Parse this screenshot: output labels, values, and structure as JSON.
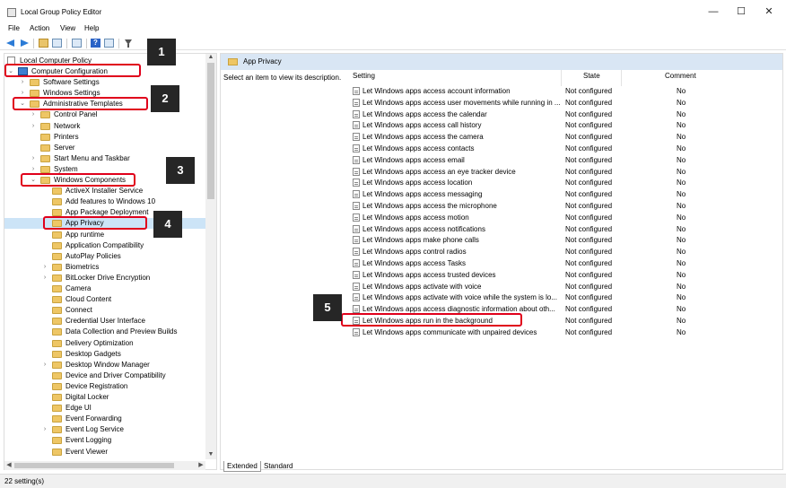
{
  "window": {
    "title": "Local Group Policy Editor",
    "minimize_glyph": "—",
    "maximize_glyph": "☐",
    "close_glyph": "✕"
  },
  "menu": [
    "File",
    "Action",
    "View",
    "Help"
  ],
  "tree": {
    "root": "Local Computer Policy",
    "items": [
      {
        "label": "Computer Configuration",
        "level": 0,
        "expander": "v",
        "icon": "computer-icon"
      },
      {
        "label": "Software Settings",
        "level": 1,
        "expander": ">",
        "icon": "folder-icon"
      },
      {
        "label": "Windows Settings",
        "level": 1,
        "expander": ">",
        "icon": "folder-icon"
      },
      {
        "label": "Administrative Templates",
        "level": 1,
        "expander": "v",
        "icon": "folder-icon"
      },
      {
        "label": "Control Panel",
        "level": 2,
        "expander": ">",
        "icon": "folder-icon"
      },
      {
        "label": "Network",
        "level": 2,
        "expander": ">",
        "icon": "folder-icon"
      },
      {
        "label": "Printers",
        "level": 2,
        "expander": "",
        "icon": "folder-icon"
      },
      {
        "label": "Server",
        "level": 2,
        "expander": "",
        "icon": "folder-icon"
      },
      {
        "label": "Start Menu and Taskbar",
        "level": 2,
        "expander": ">",
        "icon": "folder-icon"
      },
      {
        "label": "System",
        "level": 2,
        "expander": ">",
        "icon": "folder-icon"
      },
      {
        "label": "Windows Components",
        "level": 2,
        "expander": "v",
        "icon": "folder-icon"
      },
      {
        "label": "ActiveX Installer Service",
        "level": 3,
        "expander": "",
        "icon": "folder-icon"
      },
      {
        "label": "Add features to Windows 10",
        "level": 3,
        "expander": "",
        "icon": "folder-icon"
      },
      {
        "label": "App Package Deployment",
        "level": 3,
        "expander": "",
        "icon": "folder-icon"
      },
      {
        "label": "App Privacy",
        "level": 3,
        "expander": "",
        "icon": "folder-icon",
        "selected": true
      },
      {
        "label": "App runtime",
        "level": 3,
        "expander": "",
        "icon": "folder-icon"
      },
      {
        "label": "Application Compatibility",
        "level": 3,
        "expander": "",
        "icon": "folder-icon"
      },
      {
        "label": "AutoPlay Policies",
        "level": 3,
        "expander": "",
        "icon": "folder-icon"
      },
      {
        "label": "Biometrics",
        "level": 3,
        "expander": ">",
        "icon": "folder-icon"
      },
      {
        "label": "BitLocker Drive Encryption",
        "level": 3,
        "expander": ">",
        "icon": "folder-icon"
      },
      {
        "label": "Camera",
        "level": 3,
        "expander": "",
        "icon": "folder-icon"
      },
      {
        "label": "Cloud Content",
        "level": 3,
        "expander": "",
        "icon": "folder-icon"
      },
      {
        "label": "Connect",
        "level": 3,
        "expander": "",
        "icon": "folder-icon"
      },
      {
        "label": "Credential User Interface",
        "level": 3,
        "expander": "",
        "icon": "folder-icon"
      },
      {
        "label": "Data Collection and Preview Builds",
        "level": 3,
        "expander": "",
        "icon": "folder-icon"
      },
      {
        "label": "Delivery Optimization",
        "level": 3,
        "expander": "",
        "icon": "folder-icon"
      },
      {
        "label": "Desktop Gadgets",
        "level": 3,
        "expander": "",
        "icon": "folder-icon"
      },
      {
        "label": "Desktop Window Manager",
        "level": 3,
        "expander": ">",
        "icon": "folder-icon"
      },
      {
        "label": "Device and Driver Compatibility",
        "level": 3,
        "expander": "",
        "icon": "folder-icon"
      },
      {
        "label": "Device Registration",
        "level": 3,
        "expander": "",
        "icon": "folder-icon"
      },
      {
        "label": "Digital Locker",
        "level": 3,
        "expander": "",
        "icon": "folder-icon"
      },
      {
        "label": "Edge UI",
        "level": 3,
        "expander": "",
        "icon": "folder-icon"
      },
      {
        "label": "Event Forwarding",
        "level": 3,
        "expander": "",
        "icon": "folder-icon"
      },
      {
        "label": "Event Log Service",
        "level": 3,
        "expander": ">",
        "icon": "folder-icon"
      },
      {
        "label": "Event Logging",
        "level": 3,
        "expander": "",
        "icon": "folder-icon"
      },
      {
        "label": "Event Viewer",
        "level": 3,
        "expander": "",
        "icon": "folder-icon"
      }
    ]
  },
  "panel": {
    "title": "App Privacy",
    "description": "Select an item to view its description.",
    "columns": {
      "setting": "Setting",
      "state": "State",
      "comment": "Comment"
    },
    "rows": [
      {
        "name": "Let Windows apps access account information",
        "state": "Not configured",
        "comment": "No"
      },
      {
        "name": "Let Windows apps access user movements while running in ...",
        "state": "Not configured",
        "comment": "No"
      },
      {
        "name": "Let Windows apps access the calendar",
        "state": "Not configured",
        "comment": "No"
      },
      {
        "name": "Let Windows apps access call history",
        "state": "Not configured",
        "comment": "No"
      },
      {
        "name": "Let Windows apps access the camera",
        "state": "Not configured",
        "comment": "No"
      },
      {
        "name": "Let Windows apps access contacts",
        "state": "Not configured",
        "comment": "No"
      },
      {
        "name": "Let Windows apps access email",
        "state": "Not configured",
        "comment": "No"
      },
      {
        "name": "Let Windows apps access an eye tracker device",
        "state": "Not configured",
        "comment": "No"
      },
      {
        "name": "Let Windows apps access location",
        "state": "Not configured",
        "comment": "No"
      },
      {
        "name": "Let Windows apps access messaging",
        "state": "Not configured",
        "comment": "No"
      },
      {
        "name": "Let Windows apps access the microphone",
        "state": "Not configured",
        "comment": "No"
      },
      {
        "name": "Let Windows apps access motion",
        "state": "Not configured",
        "comment": "No"
      },
      {
        "name": "Let Windows apps access notifications",
        "state": "Not configured",
        "comment": "No"
      },
      {
        "name": "Let Windows apps make phone calls",
        "state": "Not configured",
        "comment": "No"
      },
      {
        "name": "Let Windows apps control radios",
        "state": "Not configured",
        "comment": "No"
      },
      {
        "name": "Let Windows apps access Tasks",
        "state": "Not configured",
        "comment": "No"
      },
      {
        "name": "Let Windows apps access trusted devices",
        "state": "Not configured",
        "comment": "No"
      },
      {
        "name": "Let Windows apps activate with voice",
        "state": "Not configured",
        "comment": "No"
      },
      {
        "name": "Let Windows apps activate with voice while the system is lo...",
        "state": "Not configured",
        "comment": "No"
      },
      {
        "name": "Let Windows apps access diagnostic information about oth...",
        "state": "Not configured",
        "comment": "No"
      },
      {
        "name": "Let Windows apps run in the background",
        "state": "Not configured",
        "comment": "No"
      },
      {
        "name": "Let Windows apps communicate with unpaired devices",
        "state": "Not configured",
        "comment": "No"
      }
    ]
  },
  "tabs": [
    "Extended",
    "Standard"
  ],
  "status": "22 setting(s)",
  "callouts": [
    "1",
    "2",
    "3",
    "4",
    "5"
  ],
  "colors": {
    "highlight": "#e0001b",
    "badge": "#262626",
    "header": "#d9e6f4"
  }
}
